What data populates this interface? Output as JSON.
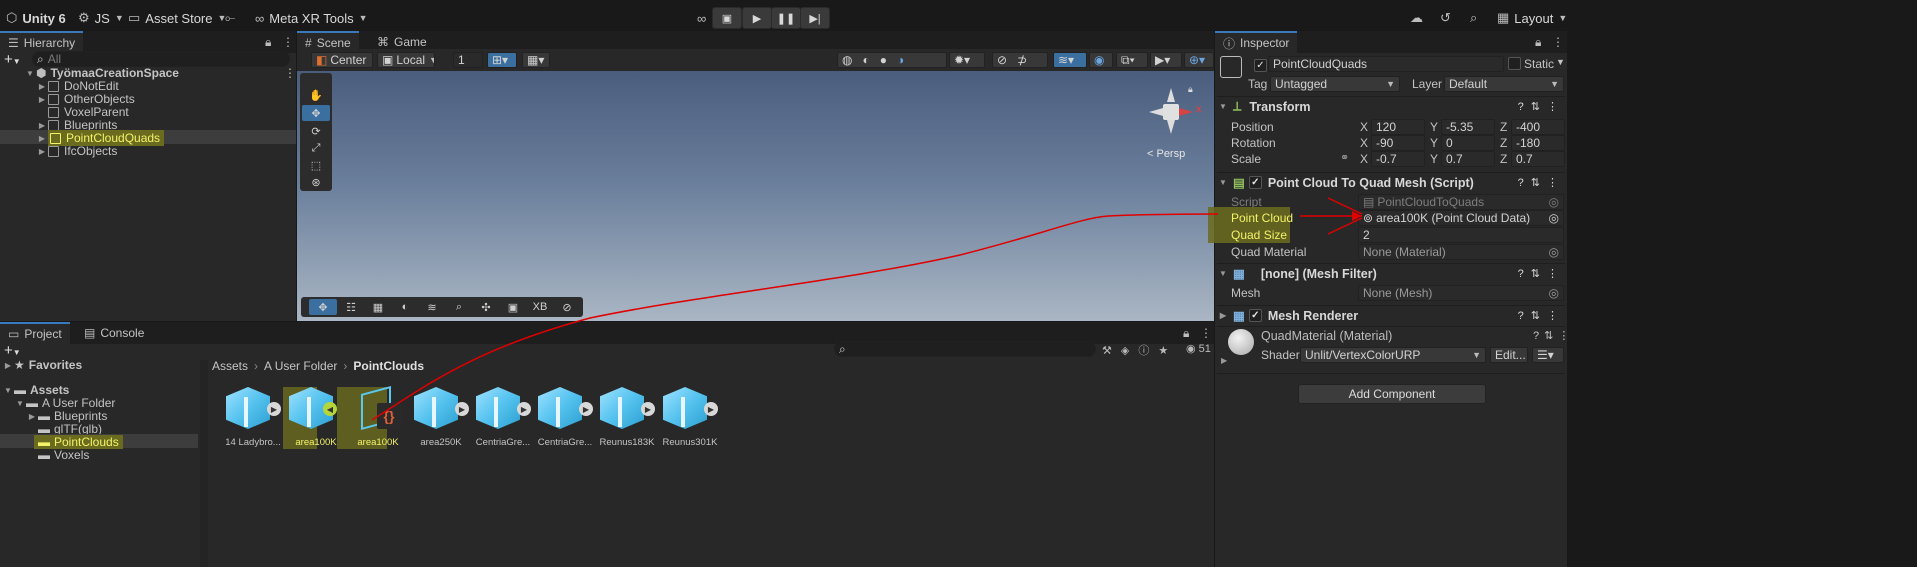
{
  "topbar": {
    "product": "Unity 6",
    "account": "JS",
    "asset_store": "Asset Store",
    "meta_tools": "Meta XR Tools",
    "layout": "Layout"
  },
  "hierarchy": {
    "tab": "Hierarchy",
    "search_placeholder": "All",
    "scene": "TyömaaCreationSpace",
    "items": [
      "DoNotEdit",
      "OtherObjects",
      "VoxelParent",
      "Blueprints",
      "PointCloudQuads",
      "IfcObjects"
    ]
  },
  "scene_view": {
    "tabs": [
      "Scene",
      "Game"
    ],
    "pivot": "Center",
    "space": "Local",
    "snap_value": "1",
    "persp": "< Persp",
    "bottom_tool_label": "XB"
  },
  "project": {
    "tabs": [
      "Project",
      "Console"
    ],
    "favorites": "Favorites",
    "assets": "Assets",
    "tree": [
      "A User Folder",
      "Blueprints",
      "glTF(glb)",
      "PointClouds",
      "Voxels"
    ],
    "breadcrumb": [
      "Assets",
      "A User Folder",
      "PointClouds"
    ],
    "count": "51",
    "files": [
      "14 Ladybro...",
      "area100K",
      "area100K",
      "area250K",
      "CentriaGre...",
      "CentriaGre...",
      "Reunus183K",
      "Reunus301K"
    ]
  },
  "inspector": {
    "tab": "Inspector",
    "object_name": "PointCloudQuads",
    "static": "Static",
    "tag_label": "Tag",
    "tag_value": "Untagged",
    "layer_label": "Layer",
    "layer_value": "Default",
    "transform": {
      "title": "Transform",
      "position_label": "Position",
      "rotation_label": "Rotation",
      "scale_label": "Scale",
      "position": {
        "x": "120",
        "y": "-5.35",
        "z": "-400"
      },
      "rotation": {
        "x": "-90",
        "y": "0",
        "z": "-180"
      },
      "scale": {
        "x": "-0.7",
        "y": "0.7",
        "z": "0.7"
      }
    },
    "script_component": {
      "title": "Point Cloud To Quad Mesh (Script)",
      "script_label": "Script",
      "script_value": "PointCloudToQuads",
      "point_cloud_label": "Point Cloud",
      "point_cloud_value": "area100K (Point Cloud Data)",
      "quad_size_label": "Quad Size",
      "quad_size_value": "2",
      "quad_material_label": "Quad Material",
      "quad_material_value": "None (Material)"
    },
    "mesh_filter": {
      "title": "[none] (Mesh Filter)",
      "mesh_label": "Mesh",
      "mesh_value": "None (Mesh)"
    },
    "mesh_renderer": {
      "title": "Mesh Renderer"
    },
    "material": {
      "name": "QuadMaterial (Material)",
      "shader_label": "Shader",
      "shader_value": "Unlit/VertexColorURP",
      "edit_label": "Edit..."
    },
    "add_component": "Add Component"
  },
  "colors": {
    "highlight": "#f3f36a",
    "annotation": "#e00000",
    "accent": "#3a79bb"
  }
}
